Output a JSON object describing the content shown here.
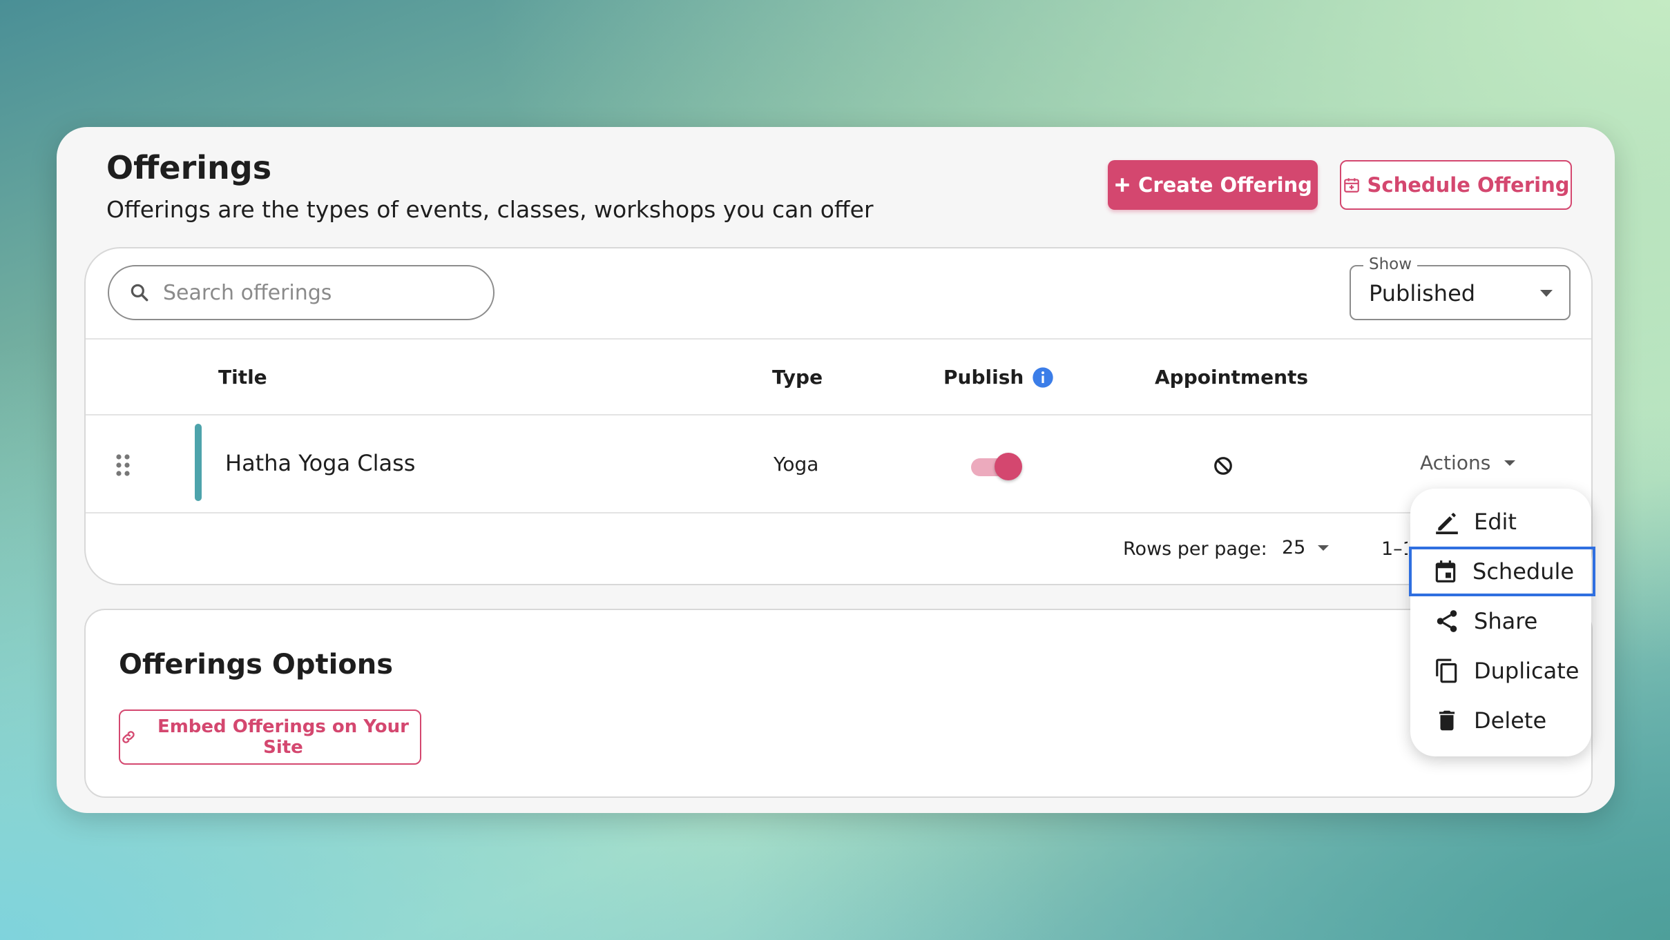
{
  "header": {
    "title": "Offerings",
    "subtitle": "Offerings are the types of events, classes, workshops you can offer",
    "create_label": "Create Offering",
    "schedule_label": "Schedule Offering"
  },
  "search": {
    "placeholder": "Search offerings"
  },
  "filter": {
    "label": "Show",
    "value": "Published"
  },
  "table": {
    "columns": [
      "Title",
      "Type",
      "Publish",
      "Appointments"
    ],
    "rows": [
      {
        "title": "Hatha Yoga Class",
        "type": "Yoga",
        "published": true,
        "appointments": "none",
        "actions_label": "Actions"
      }
    ],
    "footer": {
      "rows_per_page_label": "Rows per page:",
      "rows_per_page": "25",
      "range": "1–1"
    }
  },
  "options": {
    "title": "Offerings Options",
    "embed_label": "Embed Offerings on Your Site"
  },
  "actions_menu": {
    "items": [
      {
        "label": "Edit",
        "icon": "pencil-icon"
      },
      {
        "label": "Schedule",
        "icon": "calendar-icon",
        "highlighted": true
      },
      {
        "label": "Share",
        "icon": "share-icon"
      },
      {
        "label": "Duplicate",
        "icon": "copy-icon"
      },
      {
        "label": "Delete",
        "icon": "trash-icon"
      }
    ]
  },
  "colors": {
    "accent": "#d4476f",
    "row_accent": "#4da3ab",
    "highlight": "#2f6fe0",
    "info": "#3b7de8"
  }
}
